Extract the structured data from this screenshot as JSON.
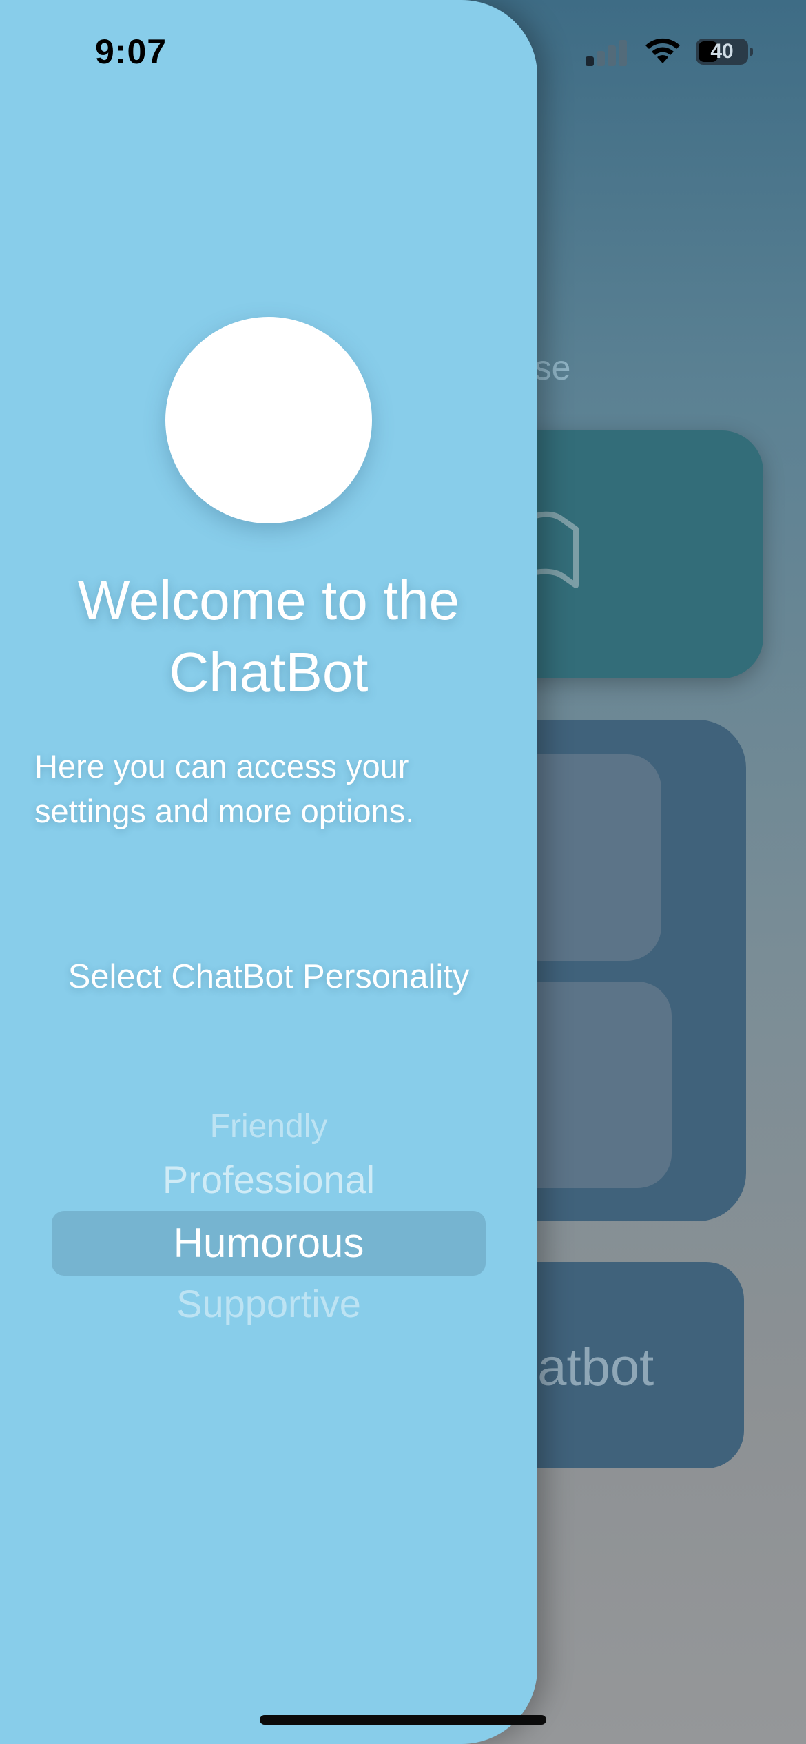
{
  "status_bar": {
    "time": "9:07",
    "battery_level": "40",
    "icons": [
      "cellular-signal-icon",
      "wifi-icon",
      "battery-icon"
    ]
  },
  "background": {
    "choose_text_partial": "hose",
    "chatbot_button_partial": "hatbot",
    "card_icon": "book-icon"
  },
  "drawer": {
    "title": "Welcome to the ChatBot",
    "subtitle": "Here you can access your settings and more options.",
    "personality_label": "Select ChatBot Personality",
    "personality_options": [
      "Friendly",
      "Professional",
      "Humorous",
      "Supportive"
    ],
    "selected_personality": "Humorous"
  },
  "colors": {
    "drawer": "#88cdea",
    "teal_card": "#336d79",
    "blue_card": "#40627b"
  }
}
